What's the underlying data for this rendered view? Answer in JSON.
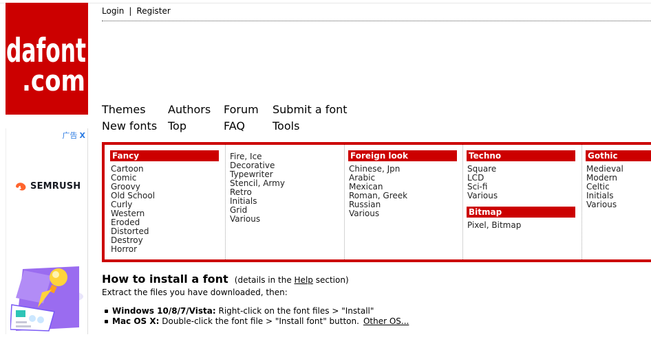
{
  "logo": {
    "line1": "dafont",
    "line2": ".com"
  },
  "auth": {
    "login": "Login",
    "separator": "|",
    "register": "Register"
  },
  "nav": [
    {
      "label": "Themes"
    },
    {
      "label": "Authors"
    },
    {
      "label": "Forum"
    },
    {
      "label": "Submit a font"
    },
    {
      "label": "New fonts"
    },
    {
      "label": "Top"
    },
    {
      "label": "FAQ"
    },
    {
      "label": "Tools"
    }
  ],
  "ad": {
    "label": "广告",
    "close": "X",
    "brand": "SEMRUSH"
  },
  "categories": [
    {
      "heading": "Fancy",
      "items": [
        "Cartoon",
        "Comic",
        "Groovy",
        "Old School",
        "Curly",
        "Western",
        "Eroded",
        "Distorted",
        "Destroy",
        "Horror"
      ]
    },
    {
      "heading": "",
      "items": [
        "Fire, Ice",
        "Decorative",
        "Typewriter",
        "Stencil, Army",
        "Retro",
        "Initials",
        "Grid",
        "Various"
      ]
    },
    {
      "heading": "Foreign look",
      "items": [
        "Chinese, Jpn",
        "Arabic",
        "Mexican",
        "Roman, Greek",
        "Russian",
        "Various"
      ]
    },
    {
      "heading": "Techno",
      "items": [
        "Square",
        "LCD",
        "Sci-fi",
        "Various"
      ],
      "heading2": "Bitmap",
      "items2": [
        "Pixel, Bitmap"
      ]
    },
    {
      "heading": "Gothic",
      "items": [
        "Medieval",
        "Modern",
        "Celtic",
        "Initials",
        "Various"
      ]
    }
  ],
  "install": {
    "title": "How to install a font",
    "details_prefix": "(details in the",
    "details_link": "Help",
    "details_suffix": "section)",
    "extract": "Extract the files you have downloaded, then:",
    "windows_label": "Windows 10/8/7/Vista:",
    "windows_text": "Right-click on the font files > \"Install\"",
    "mac_label": "Mac OS X:",
    "mac_text": "Double-click the font file > \"Install font\" button.",
    "other_os": "Other OS..."
  },
  "colors": {
    "brand_red": "#cc0000",
    "ad_blue": "#2a7ae2",
    "semrush_orange": "#ff642d"
  }
}
